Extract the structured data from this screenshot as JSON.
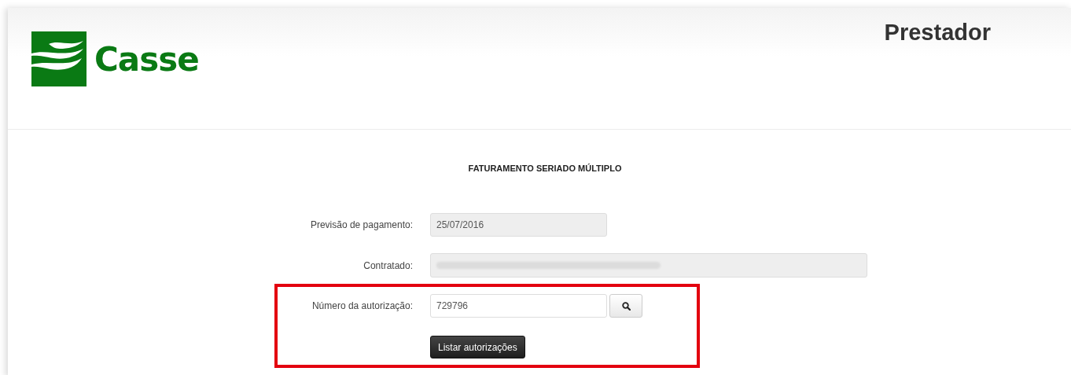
{
  "header": {
    "brand": "Casse",
    "section": "Prestador"
  },
  "form": {
    "title": "FATURAMENTO SERIADO MÚLTIPLO",
    "groups": [
      {
        "highlighted": false,
        "rows": [
          {
            "label": "Previsão de pagamento:",
            "kind": "readonly",
            "value": "25/07/2016"
          },
          {
            "label": "Contratado:",
            "kind": "redacted"
          }
        ]
      },
      {
        "highlighted": true,
        "rows": [
          {
            "label": "Número da autorização:",
            "kind": "search",
            "value": "729796"
          }
        ],
        "button": "Listar autorizações"
      }
    ]
  }
}
